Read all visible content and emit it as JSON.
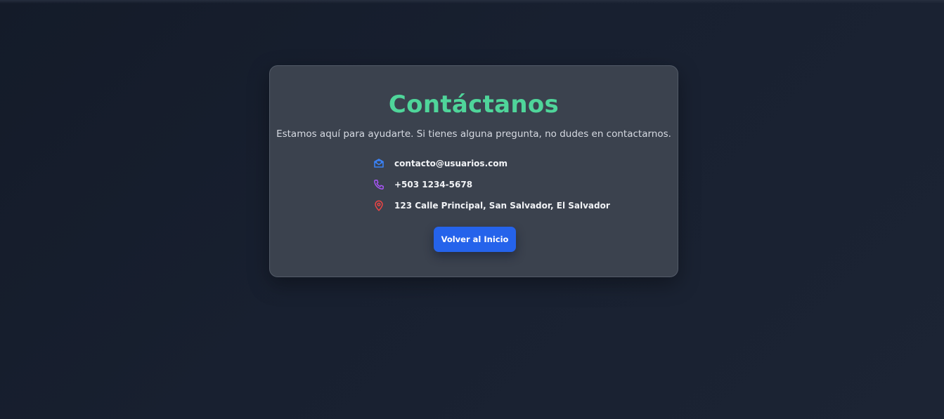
{
  "page": {
    "title": "Contáctanos",
    "subtitle": "Estamos aquí para ayudarte. Si tienes alguna pregunta, no dudes en contactarnos."
  },
  "contact": {
    "items": [
      {
        "icon": "email-icon",
        "color": "#3b82f6",
        "text": "contacto@usuarios.com"
      },
      {
        "icon": "phone-icon",
        "color": "#a855f7",
        "text": "+503 1234-5678"
      },
      {
        "icon": "location-pin-icon",
        "color": "#ef4444",
        "text": "123 Calle Principal, San Salvador, El Salvador"
      }
    ]
  },
  "actions": {
    "back_label": "Volver al Inicio"
  },
  "colors": {
    "title": "#4fd59a",
    "button": "#2563eb",
    "card": "#3b424e",
    "background": "#182030"
  }
}
